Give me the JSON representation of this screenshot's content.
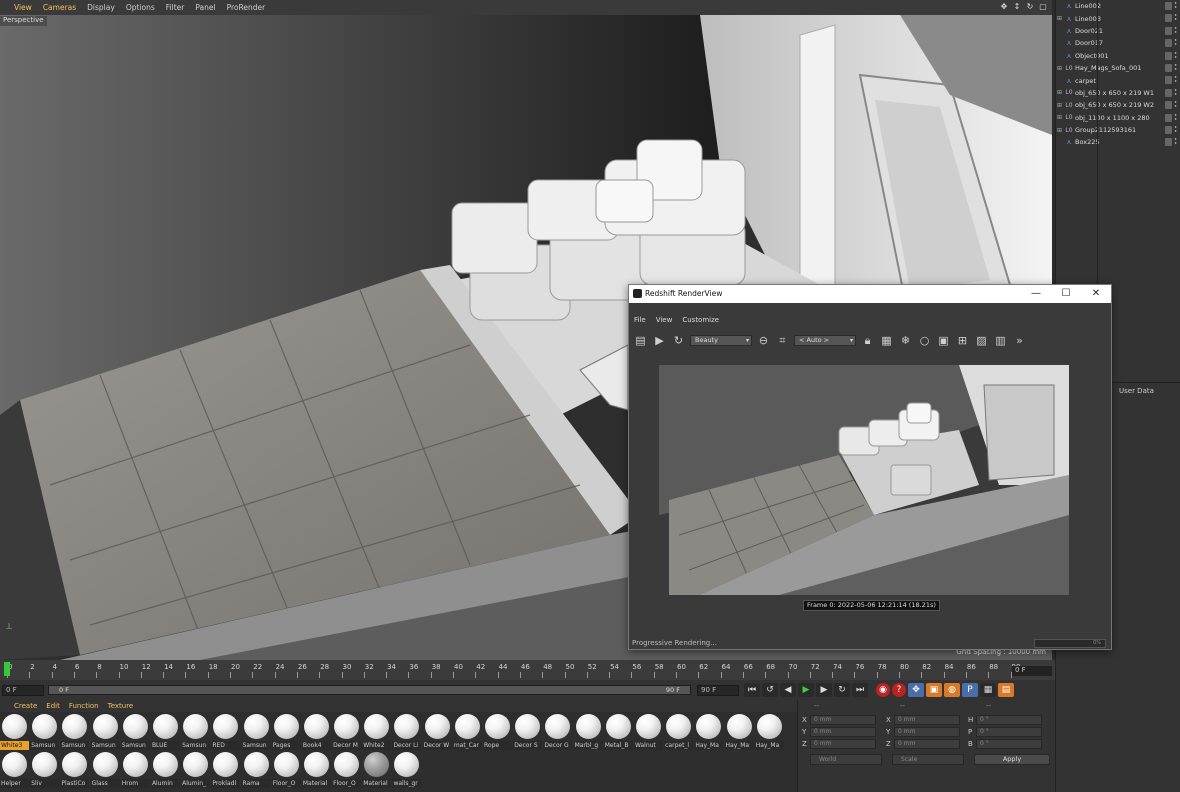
{
  "viewport": {
    "menu": [
      "View",
      "Cameras",
      "Display",
      "Options",
      "Filter",
      "Panel",
      "ProRender"
    ],
    "camera_label": "Perspective",
    "grid_spacing": "Grid Spacing : 10000 mm",
    "nav_icons": [
      "move-icon",
      "zoom-icon",
      "rotate-icon",
      "maximize-icon"
    ]
  },
  "objects": [
    {
      "name": "Line002",
      "type": "spline",
      "expandable": false
    },
    {
      "name": "Line003",
      "type": "spline",
      "expandable": true
    },
    {
      "name": "Door021",
      "type": "spline",
      "expandable": false
    },
    {
      "name": "Door017",
      "type": "spline",
      "expandable": false
    },
    {
      "name": "Object001",
      "type": "spline",
      "expandable": false
    },
    {
      "name": "Hay_Mags_Sofa_001",
      "type": "null",
      "expandable": true
    },
    {
      "name": "carpet",
      "type": "spline",
      "expandable": false
    },
    {
      "name": "obj_650 x 650 x 219 W1",
      "type": "null",
      "expandable": true
    },
    {
      "name": "obj_650 x 650 x 219 W2",
      "type": "null",
      "expandable": true
    },
    {
      "name": "obj_1100 x 1100 x 280",
      "type": "null",
      "expandable": true
    },
    {
      "name": "Group2112593161",
      "type": "null",
      "expandable": true
    },
    {
      "name": "Box225",
      "type": "spline",
      "expandable": false
    }
  ],
  "attributes": {
    "tab": "User Data"
  },
  "timeline": {
    "ticks": [
      "0",
      "2",
      "4",
      "6",
      "8",
      "10",
      "12",
      "14",
      "16",
      "18",
      "20",
      "22",
      "24",
      "26",
      "28",
      "30",
      "32",
      "34",
      "36",
      "38",
      "40",
      "42",
      "44",
      "46",
      "48",
      "50",
      "52",
      "54",
      "56",
      "58",
      "60",
      "62",
      "64",
      "66",
      "68",
      "70",
      "72",
      "74",
      "76",
      "78",
      "80",
      "82",
      "84",
      "86",
      "88",
      "90"
    ],
    "end_frame_display": "0 F",
    "start_field": "0 F",
    "range_start": "0 F",
    "range_end": "90 F",
    "max_field": "90 F",
    "transport_icons": [
      {
        "name": "go-to-start-icon",
        "glyph": "⏮",
        "style": ""
      },
      {
        "name": "loop-left-icon",
        "glyph": "↺",
        "style": ""
      },
      {
        "name": "prev-frame-icon",
        "glyph": "◀",
        "style": ""
      },
      {
        "name": "play-icon",
        "glyph": "▶",
        "style": "green"
      },
      {
        "name": "next-frame-icon",
        "glyph": "▶",
        "style": ""
      },
      {
        "name": "loop-right-icon",
        "glyph": "↻",
        "style": ""
      },
      {
        "name": "go-to-end-icon",
        "glyph": "⏭",
        "style": ""
      },
      {
        "name": "record-icon",
        "glyph": "",
        "style": "spacer"
      },
      {
        "name": "autokey-icon",
        "glyph": "◉",
        "style": "red"
      },
      {
        "name": "keyframe-icon",
        "glyph": "?",
        "style": "red"
      },
      {
        "name": "position-key-icon",
        "glyph": "✥",
        "style": "blue"
      },
      {
        "name": "scale-key-icon",
        "glyph": "▣",
        "style": "orange"
      },
      {
        "name": "rotation-key-icon",
        "glyph": "◍",
        "style": "orange"
      },
      {
        "name": "param-key-icon",
        "glyph": "P",
        "style": "blue"
      },
      {
        "name": "pla-key-icon",
        "glyph": "▦",
        "style": ""
      },
      {
        "name": "film-icon",
        "glyph": "▤",
        "style": "orange"
      }
    ]
  },
  "materials": {
    "menu": [
      "Create",
      "Edit",
      "Function",
      "Texture"
    ],
    "items": [
      "White3",
      "Samsun",
      "Samsun",
      "Samsun",
      "Samsun",
      "BLUE",
      "Samsun",
      "RED",
      "Samsun",
      "Pages",
      "Book4",
      "Decor M",
      "White2",
      "Decor Li",
      "Decor W",
      "mat_Car",
      "Rope",
      "Decor S",
      "Decor G",
      "Marbl_g",
      "Metal_B",
      "Walnut",
      "carpet_l",
      "Hay_Ma",
      "Hay_Ma",
      "Hay_Ma",
      "Helper",
      "Sliv",
      "PlastiCo",
      "Glass",
      "Hrom",
      "Alumin",
      "Alumin_",
      "Prokladl",
      "Rama",
      "Floor_O",
      "Material",
      "Floor_O",
      "Material",
      "walls_gr"
    ],
    "selected_index": 0,
    "grey_indices": [
      38
    ]
  },
  "coordinates": {
    "headers": [
      "--",
      "--",
      "--"
    ],
    "rows": [
      {
        "a": "X",
        "av": "0 mm",
        "b": "X",
        "bv": "0 mm",
        "c": "H",
        "cv": "0 °"
      },
      {
        "a": "Y",
        "av": "0 mm",
        "b": "Y",
        "bv": "0 mm",
        "c": "P",
        "cv": "0 °"
      },
      {
        "a": "Z",
        "av": "0 mm",
        "b": "Z",
        "bv": "0 mm",
        "c": "B",
        "cv": "0 °"
      }
    ],
    "mode": "World",
    "scale": "Scale",
    "apply": "Apply"
  },
  "redshift": {
    "title": "Redshift RenderView",
    "window_controls": [
      "—",
      "☐",
      "✕"
    ],
    "menu": [
      "File",
      "View",
      "Customize"
    ],
    "aov": "Beauty",
    "region": "< Auto >",
    "frame_info": "Frame  0:  2022-05-06  12:21:14  (18.21s)",
    "status": "Progressive Rendering...",
    "progress": "0%"
  }
}
